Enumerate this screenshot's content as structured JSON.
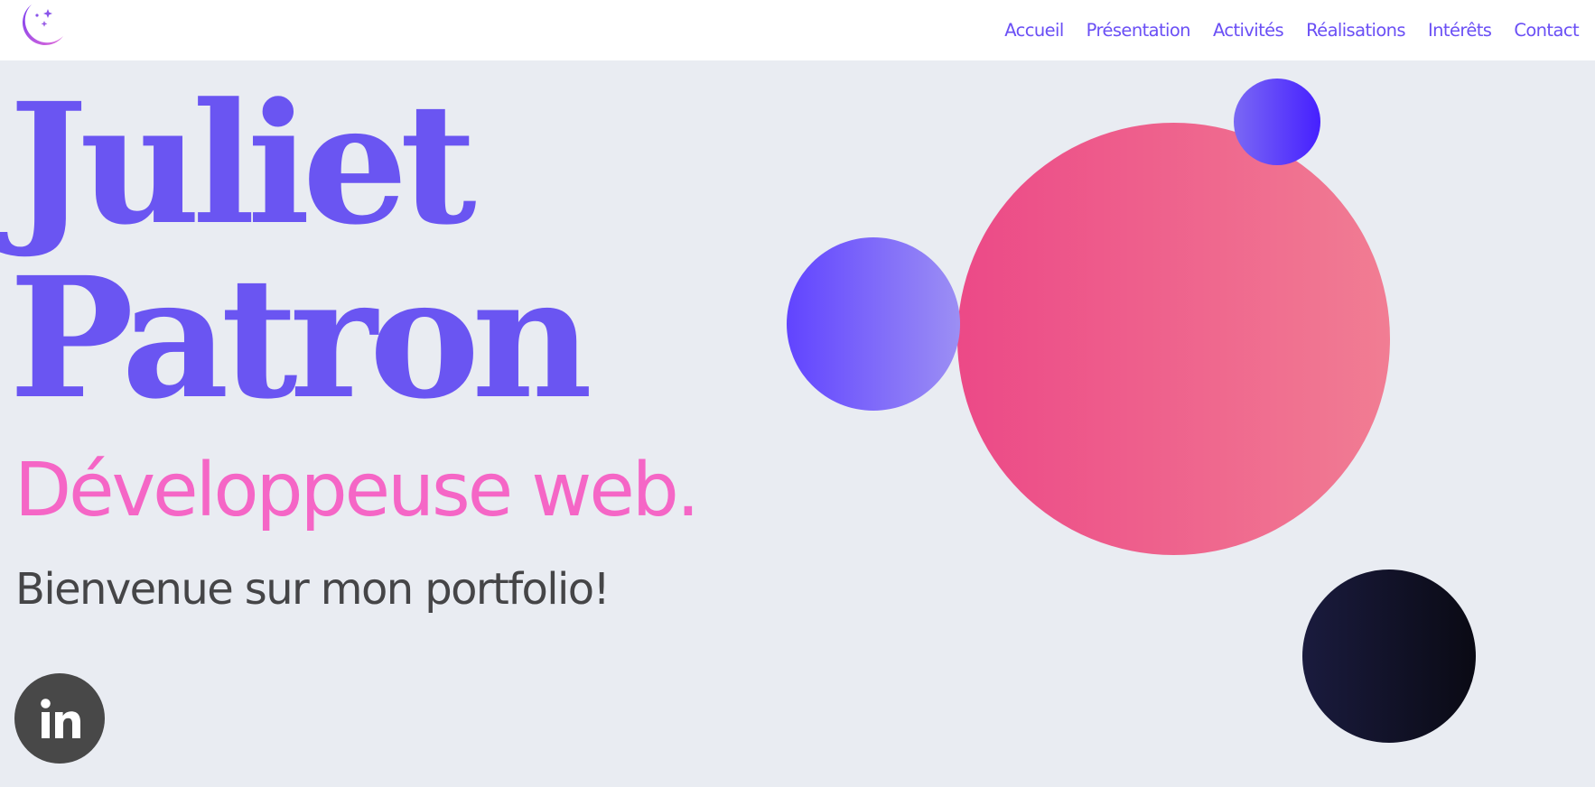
{
  "header": {
    "logo_icon": "crescent-moon-stars-icon",
    "nav": [
      {
        "label": "Accueil"
      },
      {
        "label": "Présentation"
      },
      {
        "label": "Activités"
      },
      {
        "label": "Réalisations"
      },
      {
        "label": "Intérêts"
      },
      {
        "label": "Contact"
      }
    ]
  },
  "hero": {
    "first_name": "Juliet",
    "last_name": "Patron",
    "role": "Développeuse web.",
    "welcome": "Bienvenue sur mon portfolio!"
  },
  "social": {
    "linkedin_icon": "linkedin-icon"
  },
  "colors": {
    "accent": "#6a55f2",
    "nav": "#6a4ff5",
    "pink_text": "#f566c6",
    "body_text": "#454547",
    "background": "#e9ecf2",
    "pink_circle": [
      "#ec4987",
      "#f17d93"
    ],
    "purple_circle": [
      "#6144ff",
      "#9c8ff4"
    ],
    "blue_circle": [
      "#7a68f4",
      "#4620ff"
    ],
    "dark_circle": [
      "#1a1b3e",
      "#0a0a14"
    ]
  }
}
